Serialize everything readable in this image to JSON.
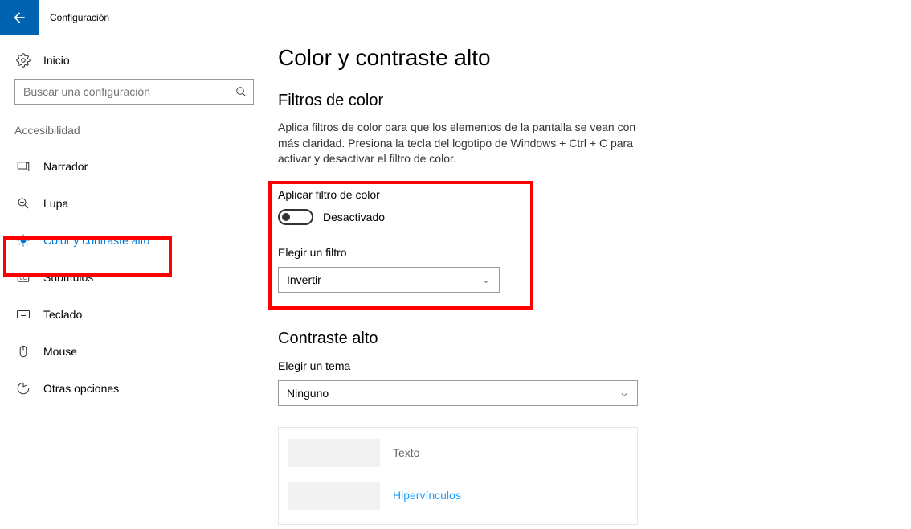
{
  "app_title": "Configuración",
  "home_label": "Inicio",
  "search": {
    "placeholder": "Buscar una configuración"
  },
  "sidebar": {
    "group": "Accesibilidad",
    "items": [
      {
        "label": "Narrador"
      },
      {
        "label": "Lupa"
      },
      {
        "label": "Color y contraste alto"
      },
      {
        "label": "Subtítulos"
      },
      {
        "label": "Teclado"
      },
      {
        "label": "Mouse"
      },
      {
        "label": "Otras opciones"
      }
    ]
  },
  "main": {
    "title": "Color y contraste alto",
    "color_filters": {
      "heading": "Filtros de color",
      "desc": "Aplica filtros de color para que los elementos de la pantalla se vean con más claridad. Presiona la tecla del logotipo de Windows + Ctrl + C para activar y desactivar el filtro de color.",
      "toggle_label": "Aplicar filtro de color",
      "toggle_state": "Desactivado",
      "choose_filter_label": "Elegir un filtro",
      "filter_value": "Invertir"
    },
    "high_contrast": {
      "heading": "Contraste alto",
      "choose_theme_label": "Elegir un tema",
      "theme_value": "Ninguno",
      "preview": {
        "text_label": "Texto",
        "hyperlinks_label": "Hipervínculos"
      }
    }
  }
}
